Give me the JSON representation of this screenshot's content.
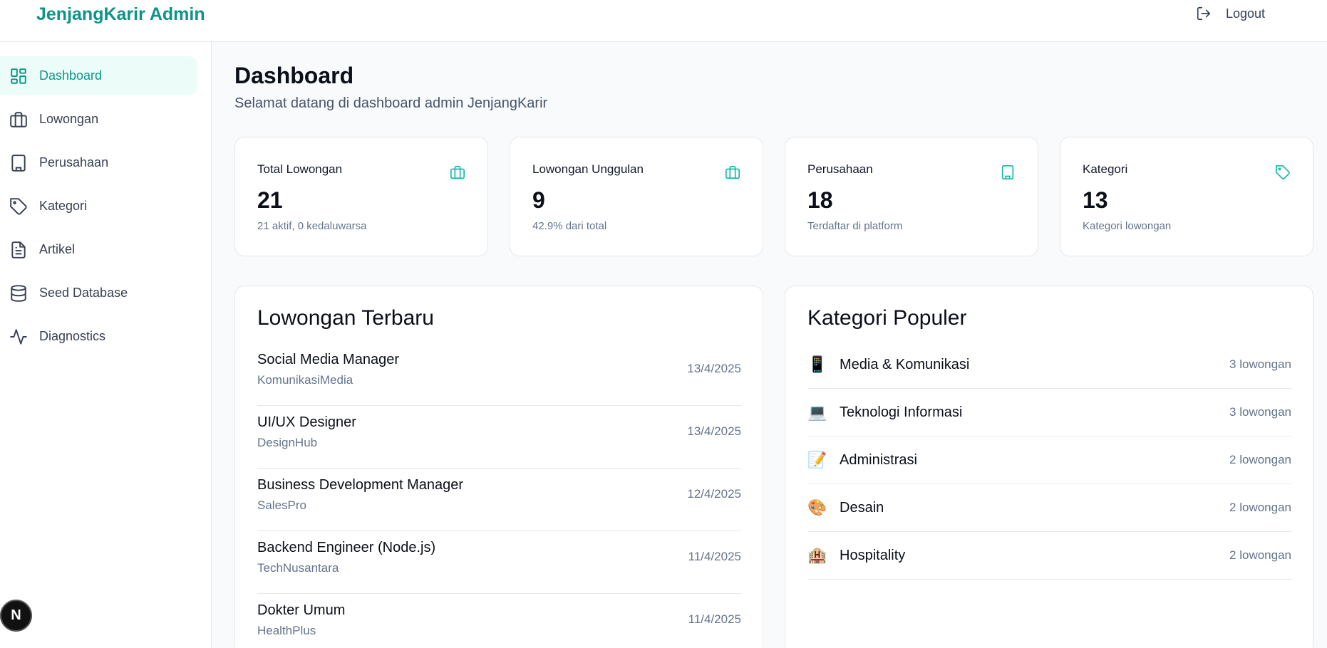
{
  "header": {
    "brand": "JenjangKarir Admin",
    "logout_label": "Logout"
  },
  "sidebar": {
    "items": [
      {
        "label": "Dashboard",
        "icon": "dashboard-icon",
        "active": true
      },
      {
        "label": "Lowongan",
        "icon": "briefcase-icon"
      },
      {
        "label": "Perusahaan",
        "icon": "building-icon"
      },
      {
        "label": "Kategori",
        "icon": "tag-icon"
      },
      {
        "label": "Artikel",
        "icon": "file-text-icon"
      },
      {
        "label": "Seed Database",
        "icon": "database-icon"
      },
      {
        "label": "Diagnostics",
        "icon": "activity-icon"
      }
    ]
  },
  "page": {
    "title": "Dashboard",
    "subtitle": "Selamat datang di dashboard admin JenjangKarir"
  },
  "stats": [
    {
      "label": "Total Lowongan",
      "value": "21",
      "note": "21 aktif, 0 kedaluwarsa",
      "icon": "briefcase-icon"
    },
    {
      "label": "Lowongan Unggulan",
      "value": "9",
      "note": "42.9% dari total",
      "icon": "briefcase-icon"
    },
    {
      "label": "Perusahaan",
      "value": "18",
      "note": "Terdaftar di platform",
      "icon": "building-icon"
    },
    {
      "label": "Kategori",
      "value": "13",
      "note": "Kategori lowongan",
      "icon": "tag-icon"
    }
  ],
  "latest_jobs": {
    "title": "Lowongan Terbaru",
    "items": [
      {
        "title": "Social Media Manager",
        "company": "KomunikasiMedia",
        "date": "13/4/2025"
      },
      {
        "title": "UI/UX Designer",
        "company": "DesignHub",
        "date": "13/4/2025"
      },
      {
        "title": "Business Development Manager",
        "company": "SalesPro",
        "date": "12/4/2025"
      },
      {
        "title": "Backend Engineer (Node.js)",
        "company": "TechNusantara",
        "date": "11/4/2025"
      },
      {
        "title": "Dokter Umum",
        "company": "HealthPlus",
        "date": "11/4/2025"
      }
    ]
  },
  "popular_categories": {
    "title": "Kategori Populer",
    "items": [
      {
        "emoji": "📱",
        "name": "Media & Komunikasi",
        "count": "3 lowongan"
      },
      {
        "emoji": "💻",
        "name": "Teknologi Informasi",
        "count": "3 lowongan"
      },
      {
        "emoji": "📝",
        "name": "Administrasi",
        "count": "2 lowongan"
      },
      {
        "emoji": "🎨",
        "name": "Desain",
        "count": "2 lowongan"
      },
      {
        "emoji": "🏨",
        "name": "Hospitality",
        "count": "2 lowongan"
      }
    ]
  },
  "floating": {
    "badge": "N"
  }
}
